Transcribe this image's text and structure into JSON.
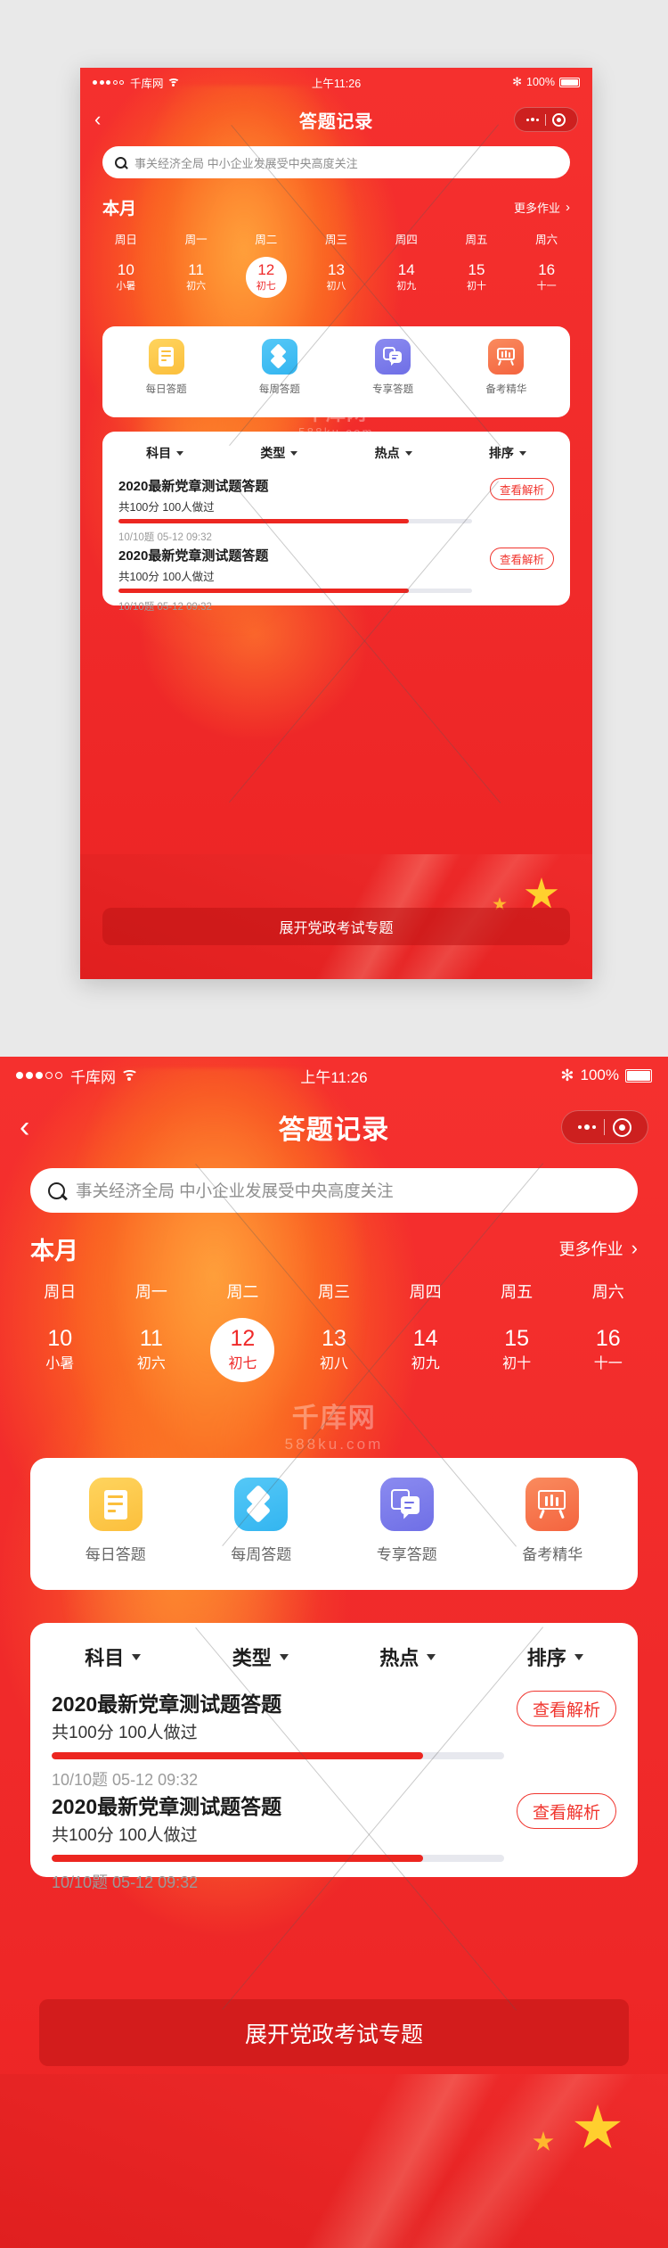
{
  "theme": {
    "brand_red": "#f02a2a",
    "accent_red": "#ec2620",
    "card_white": "#ffffff",
    "muted_gray": "#9b9b9b"
  },
  "status_bar": {
    "carrier": "千库网",
    "signal_dots_filled": 3,
    "signal_dots_total": 5,
    "wifi_icon": "wifi-icon",
    "time": "上午11:26",
    "bluetooth_icon": "bluetooth-icon",
    "battery_percent": "100%"
  },
  "nav": {
    "back_icon": "back-chevron-icon",
    "title": "答题记录",
    "capsule": {
      "more_icon": "more-dots-icon",
      "target_icon": "target-circle-icon"
    }
  },
  "search": {
    "icon": "search-icon",
    "placeholder": "事关经济全局 中小企业发展受中央高度关注",
    "value": ""
  },
  "month": {
    "title": "本月",
    "more_label": "更多作业",
    "more_chevron": "chevron-right-icon"
  },
  "calendar": {
    "weekdays": [
      "周日",
      "周一",
      "周二",
      "周三",
      "周四",
      "周五",
      "周六"
    ],
    "days": [
      {
        "num": "10",
        "lunar": "小暑",
        "selected": false
      },
      {
        "num": "11",
        "lunar": "初六",
        "selected": false
      },
      {
        "num": "12",
        "lunar": "初七",
        "selected": true
      },
      {
        "num": "13",
        "lunar": "初八",
        "selected": false
      },
      {
        "num": "14",
        "lunar": "初九",
        "selected": false
      },
      {
        "num": "15",
        "lunar": "初十",
        "selected": false
      },
      {
        "num": "16",
        "lunar": "十一",
        "selected": false
      }
    ]
  },
  "shortcuts": [
    {
      "label": "每日答题",
      "icon": "document-icon",
      "color": "#fbbf3c"
    },
    {
      "label": "每周答题",
      "icon": "diamond-stack-icon",
      "color": "#33b5f0"
    },
    {
      "label": "专享答题",
      "icon": "book-chat-icon",
      "color": "#6f6fe6"
    },
    {
      "label": "备考精华",
      "icon": "chart-board-icon",
      "color": "#f4643f"
    }
  ],
  "filters": [
    {
      "label": "科目",
      "caret": "chevron-down-icon"
    },
    {
      "label": "类型",
      "caret": "chevron-down-icon"
    },
    {
      "label": "热点",
      "caret": "chevron-down-icon"
    },
    {
      "label": "排序",
      "caret": "chevron-down-icon"
    }
  ],
  "quiz_list": [
    {
      "title": "2020最新党章测试题答题",
      "subtitle": "共100分   100人做过",
      "button": "查看解析",
      "progress_percent": 82,
      "meta": "10/10题  05-12 09:32"
    },
    {
      "title": "2020最新党章测试题答题",
      "subtitle": "共100分   100人做过",
      "button": "查看解析",
      "progress_percent": 82,
      "meta": "10/10题  05-12 09:32"
    }
  ],
  "cta": {
    "label": "展开党政考试专题"
  },
  "watermark": {
    "brand": "千库网",
    "domain": "588ku.com"
  }
}
